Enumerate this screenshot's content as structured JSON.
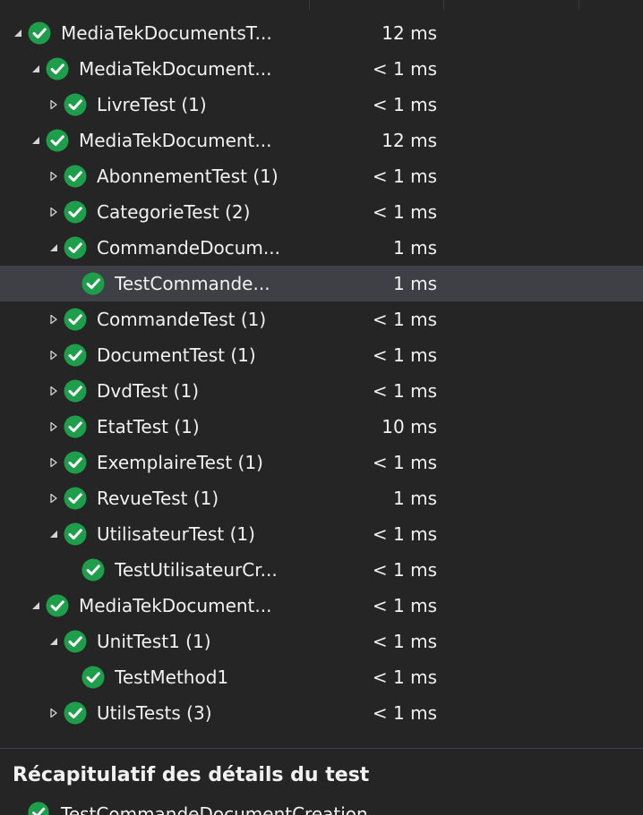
{
  "colors": {
    "background": "#252526",
    "selected_row": "#3f3f46",
    "pass_green": "#1e9e4a",
    "text": "#f1f1f1"
  },
  "tree": [
    {
      "name": "MediaTekDocumentsT...",
      "duration": "12 ms",
      "level": 0,
      "expander": "expanded",
      "selected": false
    },
    {
      "name": "MediaTekDocument...",
      "duration": "< 1 ms",
      "level": 1,
      "expander": "expanded",
      "selected": false
    },
    {
      "name": "LivreTest (1)",
      "duration": "< 1 ms",
      "level": 2,
      "expander": "collapsed",
      "selected": false
    },
    {
      "name": "MediaTekDocument...",
      "duration": "12 ms",
      "level": 1,
      "expander": "expanded",
      "selected": false
    },
    {
      "name": "AbonnementTest (1)",
      "duration": "< 1 ms",
      "level": 2,
      "expander": "collapsed",
      "selected": false
    },
    {
      "name": "CategorieTest (2)",
      "duration": "< 1 ms",
      "level": 2,
      "expander": "collapsed",
      "selected": false
    },
    {
      "name": "CommandeDocum...",
      "duration": "1 ms",
      "level": 2,
      "expander": "expanded",
      "selected": false
    },
    {
      "name": "TestCommande...",
      "duration": "1 ms",
      "level": 3,
      "expander": "none",
      "selected": true
    },
    {
      "name": "CommandeTest (1)",
      "duration": "< 1 ms",
      "level": 2,
      "expander": "collapsed",
      "selected": false
    },
    {
      "name": "DocumentTest (1)",
      "duration": "< 1 ms",
      "level": 2,
      "expander": "collapsed",
      "selected": false
    },
    {
      "name": "DvdTest (1)",
      "duration": "< 1 ms",
      "level": 2,
      "expander": "collapsed",
      "selected": false
    },
    {
      "name": "EtatTest (1)",
      "duration": "10 ms",
      "level": 2,
      "expander": "collapsed",
      "selected": false
    },
    {
      "name": "ExemplaireTest (1)",
      "duration": "< 1 ms",
      "level": 2,
      "expander": "collapsed",
      "selected": false
    },
    {
      "name": "RevueTest (1)",
      "duration": "1 ms",
      "level": 2,
      "expander": "collapsed",
      "selected": false
    },
    {
      "name": "UtilisateurTest (1)",
      "duration": "< 1 ms",
      "level": 2,
      "expander": "expanded",
      "selected": false
    },
    {
      "name": "TestUtilisateurCr...",
      "duration": "< 1 ms",
      "level": 3,
      "expander": "none",
      "selected": false
    },
    {
      "name": "MediaTekDocument...",
      "duration": "< 1 ms",
      "level": 1,
      "expander": "expanded",
      "selected": false
    },
    {
      "name": "UnitTest1 (1)",
      "duration": "< 1 ms",
      "level": 2,
      "expander": "expanded",
      "selected": false
    },
    {
      "name": "TestMethod1",
      "duration": "< 1 ms",
      "level": 3,
      "expander": "none",
      "selected": false
    },
    {
      "name": "UtilsTests (3)",
      "duration": "< 1 ms",
      "level": 2,
      "expander": "collapsed",
      "selected": false
    }
  ],
  "summary": {
    "title": "Récapitulatif des détails du test",
    "peek_text": "TestCommandeDocumentCreation"
  }
}
